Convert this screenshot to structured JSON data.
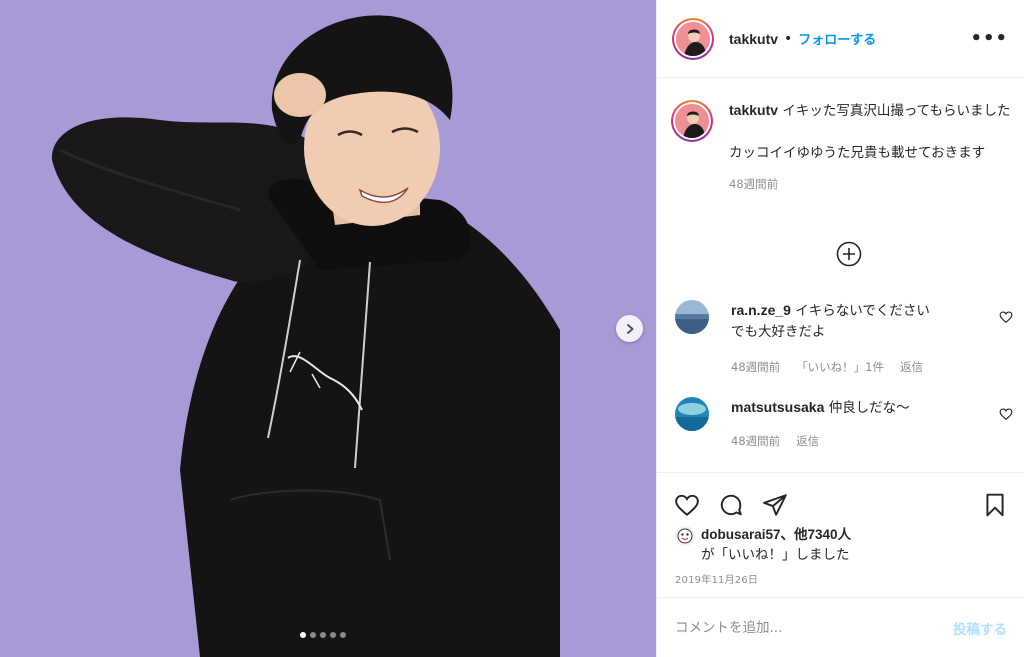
{
  "post": {
    "username": "takkutv",
    "separator": "•",
    "follow_label": "フォローする",
    "more_icon": "more-horizontal-icon",
    "carousel": {
      "total_slides": 5,
      "active_index": 0
    },
    "caption": {
      "line1": "イキッた写真沢山撮ってもらいました",
      "line2": "カッコイイゆゆうた兄貴も載せておきます",
      "time": "48週間前"
    },
    "load_more_icon": "plus-circle-icon",
    "comments": [
      {
        "username": "ra.n.ze_9",
        "text1": "イキらないでください",
        "text2": "でも大好きだよ",
        "time": "48週間前",
        "likes": "「いいね！」1件",
        "reply": "返信"
      },
      {
        "username": "matsutsusaka",
        "text1": "仲良しだな〜",
        "text2": "",
        "time": "48週間前",
        "likes": "",
        "reply": "返信"
      }
    ],
    "likes": {
      "user": "dobusarai57",
      "rest": "、他7340人",
      "line2": "が「いいね！」しました"
    },
    "date": "2019年11月26日",
    "comment_placeholder": "コメントを追加...",
    "post_button": "投稿する"
  },
  "colors": {
    "accent": "#0095f6",
    "photo_bg": "#a79ad7",
    "muted": "#8e8e8e"
  }
}
